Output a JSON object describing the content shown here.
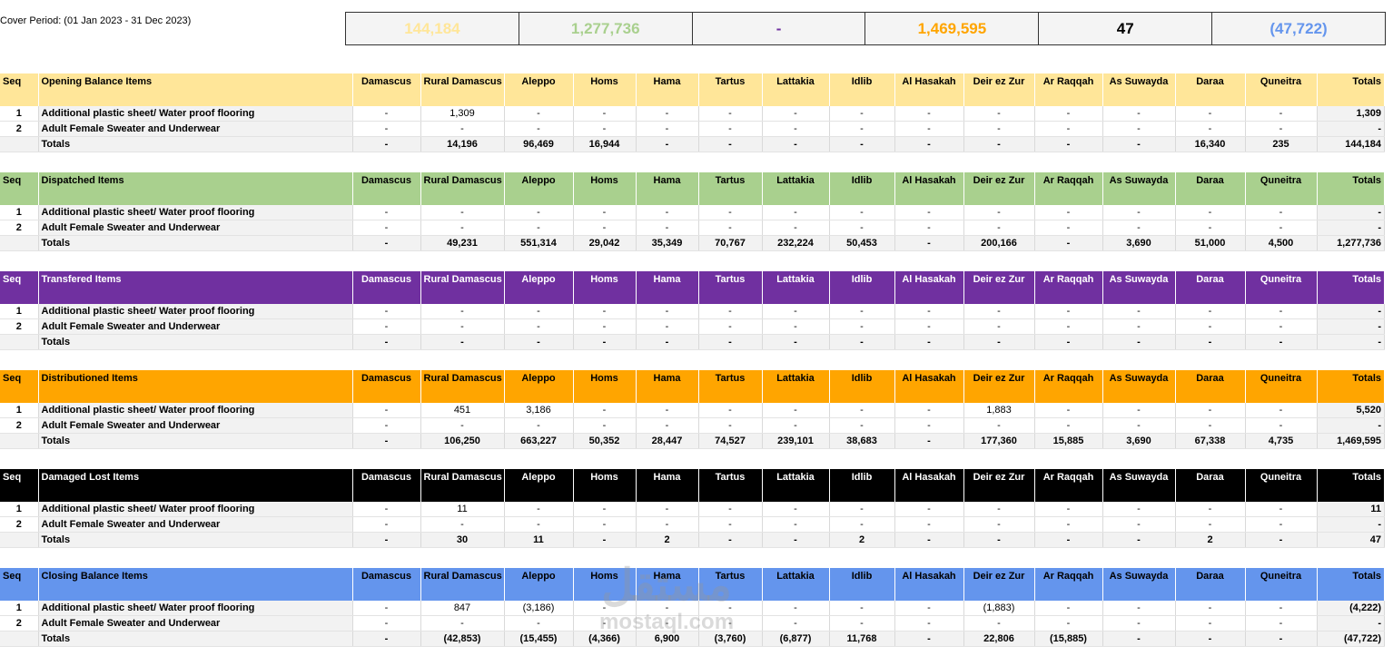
{
  "cover_period": "Cover Period: (01 Jan 2023 - 31 Dec 2023)",
  "kpis": [
    {
      "value": "144,184",
      "color": "#ffe699"
    },
    {
      "value": "1,277,736",
      "color": "#a9d08e"
    },
    {
      "value": "-",
      "color": "#7030a0"
    },
    {
      "value": "1,469,595",
      "color": "#ffa500"
    },
    {
      "value": "47",
      "color": "#000000"
    },
    {
      "value": "(47,722)",
      "color": "#6495ed"
    }
  ],
  "columns": [
    "Damascus",
    "Rural Damascus",
    "Aleppo",
    "Homs",
    "Hama",
    "Tartus",
    "Lattakia",
    "Idlib",
    "Al Hasakah",
    "Deir ez Zur",
    "Ar Raqqah",
    "As Suwayda",
    "Daraa",
    "Quneitra"
  ],
  "seq_label": "Seq",
  "totals_label": "Totals",
  "sections": [
    {
      "title": "Opening Balance Items",
      "theme": "cream",
      "rows": [
        {
          "seq": "1",
          "item": "Additional plastic sheet/ Water proof flooring",
          "values": [
            "-",
            "1,309",
            "-",
            "-",
            "-",
            "-",
            "-",
            "-",
            "-",
            "-",
            "-",
            "-",
            "-",
            "-"
          ],
          "total": "1,309"
        },
        {
          "seq": "2",
          "item": "Adult Female Sweater and Underwear",
          "values": [
            "-",
            "-",
            "-",
            "-",
            "-",
            "-",
            "-",
            "-",
            "-",
            "-",
            "-",
            "-",
            "-",
            "-"
          ],
          "total": "-"
        }
      ],
      "totals": {
        "label": "Totals",
        "values": [
          "-",
          "14,196",
          "96,469",
          "16,944",
          "-",
          "-",
          "-",
          "-",
          "-",
          "-",
          "-",
          "-",
          "16,340",
          "235"
        ],
        "total": "144,184"
      }
    },
    {
      "title": "Dispatched Items",
      "theme": "green",
      "rows": [
        {
          "seq": "1",
          "item": "Additional plastic sheet/ Water proof flooring",
          "values": [
            "-",
            "-",
            "-",
            "-",
            "-",
            "-",
            "-",
            "-",
            "-",
            "-",
            "-",
            "-",
            "-",
            "-"
          ],
          "total": "-"
        },
        {
          "seq": "2",
          "item": "Adult Female Sweater and Underwear",
          "values": [
            "-",
            "-",
            "-",
            "-",
            "-",
            "-",
            "-",
            "-",
            "-",
            "-",
            "-",
            "-",
            "-",
            "-"
          ],
          "total": "-"
        }
      ],
      "totals": {
        "label": "Totals",
        "values": [
          "-",
          "49,231",
          "551,314",
          "29,042",
          "35,349",
          "70,767",
          "232,224",
          "50,453",
          "-",
          "200,166",
          "-",
          "3,690",
          "51,000",
          "4,500"
        ],
        "total": "1,277,736"
      }
    },
    {
      "title": "Transfered Items",
      "theme": "purple",
      "rows": [
        {
          "seq": "1",
          "item": "Additional plastic sheet/ Water proof flooring",
          "values": [
            "-",
            "-",
            "-",
            "-",
            "-",
            "-",
            "-",
            "-",
            "-",
            "-",
            "-",
            "-",
            "-",
            "-"
          ],
          "total": "-"
        },
        {
          "seq": "2",
          "item": "Adult Female Sweater and Underwear",
          "values": [
            "-",
            "-",
            "-",
            "-",
            "-",
            "-",
            "-",
            "-",
            "-",
            "-",
            "-",
            "-",
            "-",
            "-"
          ],
          "total": "-"
        }
      ],
      "totals": {
        "label": "Totals",
        "values": [
          "-",
          "-",
          "-",
          "-",
          "-",
          "-",
          "-",
          "-",
          "-",
          "-",
          "-",
          "-",
          "-",
          "-"
        ],
        "total": "-"
      }
    },
    {
      "title": "Distributioned Items",
      "theme": "orange",
      "rows": [
        {
          "seq": "1",
          "item": "Additional plastic sheet/ Water proof flooring",
          "values": [
            "-",
            "451",
            "3,186",
            "-",
            "-",
            "-",
            "-",
            "-",
            "-",
            "1,883",
            "-",
            "-",
            "-",
            "-"
          ],
          "total": "5,520"
        },
        {
          "seq": "2",
          "item": "Adult Female Sweater and Underwear",
          "values": [
            "-",
            "-",
            "-",
            "-",
            "-",
            "-",
            "-",
            "-",
            "-",
            "-",
            "-",
            "-",
            "-",
            "-"
          ],
          "total": "-"
        }
      ],
      "totals": {
        "label": "Totals",
        "values": [
          "-",
          "106,250",
          "663,227",
          "50,352",
          "28,447",
          "74,527",
          "239,101",
          "38,683",
          "-",
          "177,360",
          "15,885",
          "3,690",
          "67,338",
          "4,735"
        ],
        "total": "1,469,595"
      }
    },
    {
      "title": "Damaged Lost Items",
      "theme": "black",
      "rows": [
        {
          "seq": "1",
          "item": "Additional plastic sheet/ Water proof flooring",
          "values": [
            "-",
            "11",
            "-",
            "-",
            "-",
            "-",
            "-",
            "-",
            "-",
            "-",
            "-",
            "-",
            "-",
            "-"
          ],
          "total": "11"
        },
        {
          "seq": "2",
          "item": "Adult Female Sweater and Underwear",
          "values": [
            "-",
            "-",
            "-",
            "-",
            "-",
            "-",
            "-",
            "-",
            "-",
            "-",
            "-",
            "-",
            "-",
            "-"
          ],
          "total": "-"
        }
      ],
      "totals": {
        "label": "Totals",
        "values": [
          "-",
          "30",
          "11",
          "-",
          "2",
          "-",
          "-",
          "2",
          "-",
          "-",
          "-",
          "-",
          "2",
          "-"
        ],
        "total": "47"
      }
    },
    {
      "title": "Closing Balance Items",
      "theme": "blue",
      "rows": [
        {
          "seq": "1",
          "item": "Additional plastic sheet/ Water proof flooring",
          "values": [
            "-",
            "847",
            "(3,186)",
            "-",
            "-",
            "-",
            "-",
            "-",
            "-",
            "(1,883)",
            "-",
            "-",
            "-",
            "-"
          ],
          "total": "(4,222)"
        },
        {
          "seq": "2",
          "item": "Adult Female Sweater and Underwear",
          "values": [
            "-",
            "-",
            "-",
            "-",
            "-",
            "-",
            "-",
            "-",
            "-",
            "-",
            "-",
            "-",
            "-",
            "-"
          ],
          "total": "-"
        }
      ],
      "totals": {
        "label": "Totals",
        "values": [
          "-",
          "(42,853)",
          "(15,455)",
          "(4,366)",
          "6,900",
          "(3,760)",
          "(6,877)",
          "11,768",
          "-",
          "22,806",
          "(15,885)",
          "-",
          "-",
          "-"
        ],
        "total": "(47,722)"
      }
    }
  ],
  "watermark": {
    "line1": "مستقل",
    "line2": "mostaql.com"
  }
}
